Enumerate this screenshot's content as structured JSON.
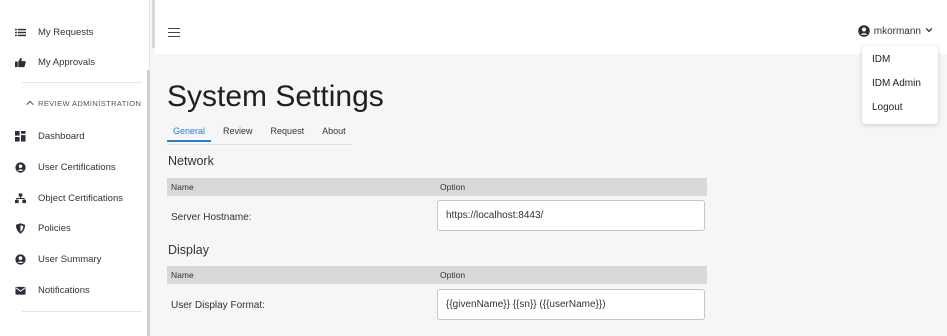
{
  "sidebar": {
    "items": [
      {
        "label": "My Requests",
        "icon": "list-icon"
      },
      {
        "label": "My Approvals",
        "icon": "thumbs-up-icon"
      }
    ],
    "section": {
      "label": "REVIEW ADMINISTRATION",
      "icon": "chevron-up-icon"
    },
    "admin_items": [
      {
        "label": "Dashboard",
        "icon": "dashboard-icon"
      },
      {
        "label": "User Certifications",
        "icon": "user-cert-icon"
      },
      {
        "label": "Object Certifications",
        "icon": "sitemap-icon"
      },
      {
        "label": "Policies",
        "icon": "shield-icon"
      },
      {
        "label": "User Summary",
        "icon": "user-circle-icon"
      },
      {
        "label": "Notifications",
        "icon": "envelope-icon"
      }
    ]
  },
  "header": {
    "menu_icon": "hamburger-icon",
    "user": {
      "name": "mkormann",
      "icon": "user-avatar-icon",
      "caret": "⌄"
    }
  },
  "dropdown": {
    "items": [
      "IDM",
      "IDM Admin",
      "Logout"
    ]
  },
  "page": {
    "title": "System Settings",
    "tabs": [
      "General",
      "Review",
      "Request",
      "About"
    ],
    "active_tab": "General",
    "sections": [
      {
        "heading": "Network",
        "columns": [
          "Name",
          "Option"
        ],
        "rows": [
          {
            "name": "Server Hostname:",
            "value": "https://localhost:8443/"
          }
        ]
      },
      {
        "heading": "Display",
        "columns": [
          "Name",
          "Option"
        ],
        "rows": [
          {
            "name": "User Display Format:",
            "value": "{{givenName}} {{sn}} ({{userName}})"
          }
        ]
      }
    ]
  },
  "colors": {
    "accent": "#2b7cd3",
    "table_header": "#d9d9dc",
    "background": "#f6f6f7"
  }
}
